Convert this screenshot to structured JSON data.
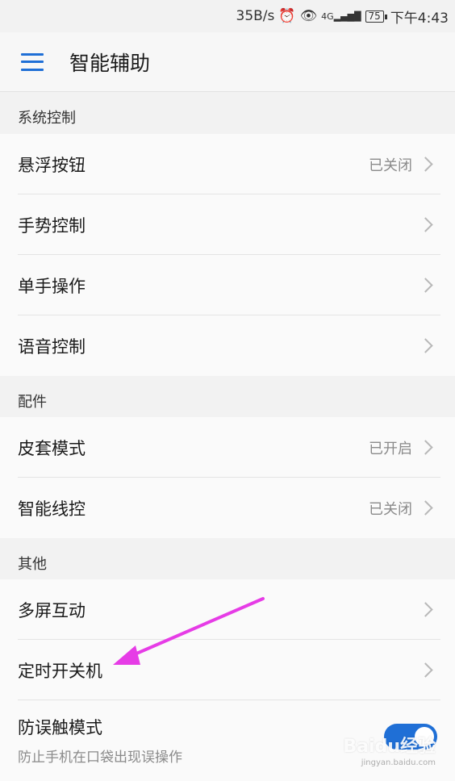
{
  "status_bar": {
    "speed": "35B/s",
    "network": "4G",
    "battery": "75",
    "time": "下午4:43"
  },
  "header": {
    "title": "智能辅助"
  },
  "sections": [
    {
      "title": "系统控制",
      "items": [
        {
          "label": "悬浮按钮",
          "status": "已关闭"
        },
        {
          "label": "手势控制",
          "status": ""
        },
        {
          "label": "单手操作",
          "status": ""
        },
        {
          "label": "语音控制",
          "status": ""
        }
      ]
    },
    {
      "title": "配件",
      "items": [
        {
          "label": "皮套模式",
          "status": "已开启"
        },
        {
          "label": "智能线控",
          "status": "已关闭"
        }
      ]
    },
    {
      "title": "其他",
      "items": [
        {
          "label": "多屏互动",
          "status": ""
        },
        {
          "label": "定时开关机",
          "status": ""
        },
        {
          "label": "防误触模式",
          "subtitle": "防止手机在口袋出现误操作",
          "toggle_on": true
        }
      ]
    }
  ],
  "watermark": {
    "text": "Baidu经验",
    "url": "jingyan.baidu.com"
  },
  "colors": {
    "accent": "#1f6fd6",
    "arrow": "#e63ce6"
  }
}
